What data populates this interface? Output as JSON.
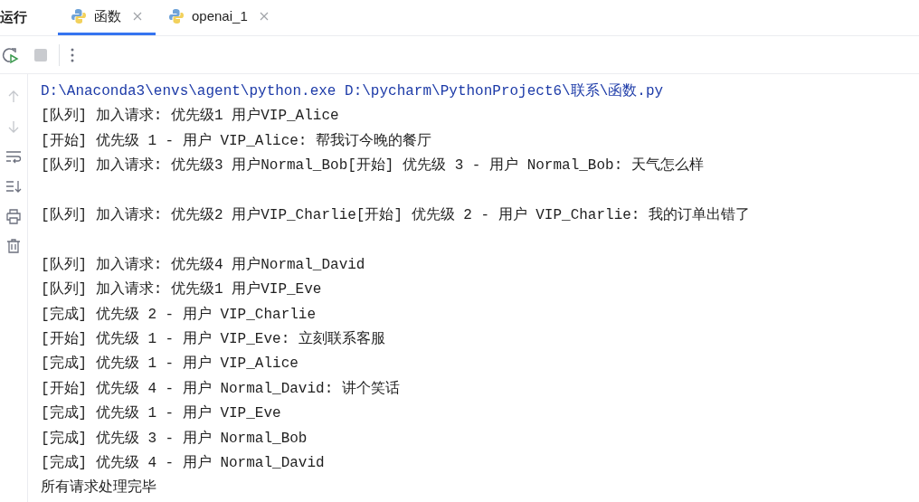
{
  "tool_window": {
    "title": "运行"
  },
  "tabs": [
    {
      "label": "函数",
      "selected": true
    },
    {
      "label": "openai_1",
      "selected": false
    }
  ],
  "toolbar": {
    "rerun_disabled": false,
    "stop_disabled": true
  },
  "side_actions": [
    {
      "kind": "up",
      "disabled": true
    },
    {
      "kind": "down",
      "disabled": true
    },
    {
      "kind": "wrap",
      "disabled": false
    },
    {
      "kind": "scroll-end",
      "disabled": false
    },
    {
      "kind": "print",
      "disabled": false
    },
    {
      "kind": "clear",
      "disabled": false
    }
  ],
  "console": [
    {
      "kind": "command",
      "text": "D:\\Anaconda3\\envs\\agent\\python.exe D:\\pycharm\\PythonProject6\\联系\\函数.py"
    },
    {
      "kind": "output",
      "text": "[队列] 加入请求: 优先级1 用户VIP_Alice"
    },
    {
      "kind": "output",
      "text": "[开始] 优先级 1 - 用户 VIP_Alice: 帮我订今晚的餐厅"
    },
    {
      "kind": "output",
      "text": "[队列] 加入请求: 优先级3 用户Normal_Bob[开始] 优先级 3 - 用户 Normal_Bob: 天气怎么样"
    },
    {
      "kind": "blank"
    },
    {
      "kind": "output",
      "text": "[队列] 加入请求: 优先级2 用户VIP_Charlie[开始] 优先级 2 - 用户 VIP_Charlie: 我的订单出错了"
    },
    {
      "kind": "blank"
    },
    {
      "kind": "output",
      "text": "[队列] 加入请求: 优先级4 用户Normal_David"
    },
    {
      "kind": "output",
      "text": "[队列] 加入请求: 优先级1 用户VIP_Eve"
    },
    {
      "kind": "output",
      "text": "[完成] 优先级 2 - 用户 VIP_Charlie"
    },
    {
      "kind": "output",
      "text": "[开始] 优先级 1 - 用户 VIP_Eve: 立刻联系客服"
    },
    {
      "kind": "output",
      "text": "[完成] 优先级 1 - 用户 VIP_Alice"
    },
    {
      "kind": "output",
      "text": "[开始] 优先级 4 - 用户 Normal_David: 讲个笑话"
    },
    {
      "kind": "output",
      "text": "[完成] 优先级 1 - 用户 VIP_Eve"
    },
    {
      "kind": "output",
      "text": "[完成] 优先级 3 - 用户 Normal_Bob"
    },
    {
      "kind": "output",
      "text": "[完成] 优先级 4 - 用户 Normal_David"
    },
    {
      "kind": "output",
      "text": "所有请求处理完毕"
    }
  ]
}
